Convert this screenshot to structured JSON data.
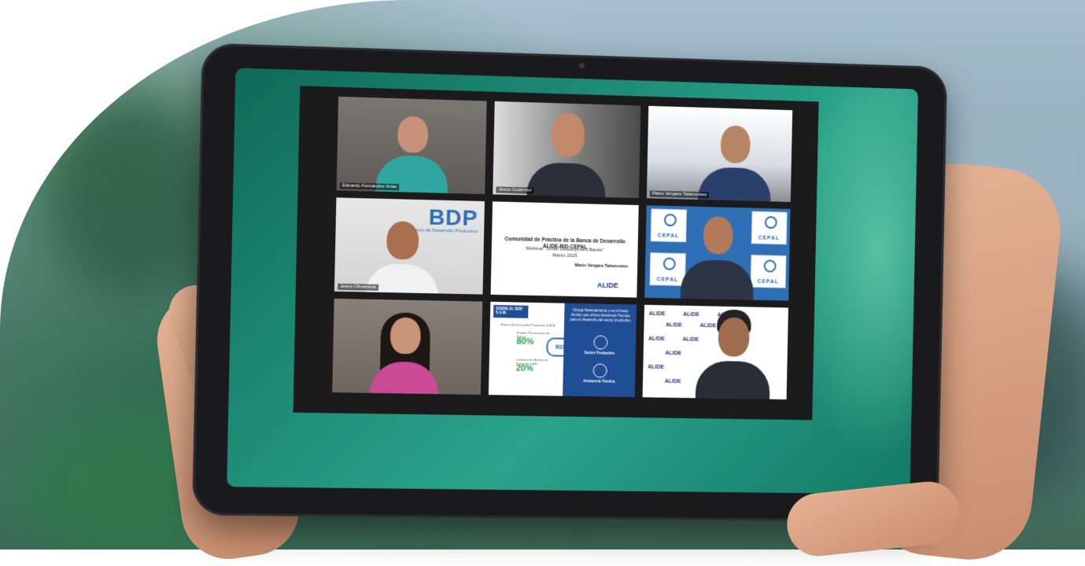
{
  "participants": [
    {
      "name": "Eduardo Fernández Arias"
    },
    {
      "name": "Jesús Gutiérrez"
    },
    {
      "name": "Mario Vergara Talamontes"
    },
    {
      "name": "Jesús Olivarrieta"
    }
  ],
  "bdp_tile": {
    "logo": "BDP",
    "subtitle": "Banco de Desarrollo Productivo"
  },
  "slide": {
    "title": "Comunidad de Práctica de la Banca de Desarrollo ALIDE-BID-CEPAL",
    "subtitle": "Webinar \"Smart Development Banks\"",
    "date": "Marzo 2025",
    "author": "Mario Vergara Talamontes",
    "logo": "ALIDE"
  },
  "cepal_tile": {
    "label": "CEPAL"
  },
  "presentation_tile": {
    "tag": "SOBRE EL BDP S.A.M.",
    "heading": "Banco de Desarrollo Productivo S.A.M.",
    "stat1_label": "Estado Plurinacional de Bolivia",
    "stat1": "80%",
    "stat2_label": "Corporación Andina de Fomento (CAF)",
    "stat2": "20%",
    "badge": "BDP",
    "right_text": "Otorga financiamiento y es el brazo técnico que ofrece Asistencia Técnica para el desarrollo del sector productivo",
    "right_label1": "Sector Productivo",
    "right_label2": "Asistencia Técnica"
  },
  "alide_wall": {
    "word": "ALIDE"
  },
  "colors": {
    "zoom_bg": "#1b1b1b",
    "screen_teal": "#1f8d76",
    "un_blue": "#2f6fb5",
    "alide_navy": "#1f3c7a"
  }
}
